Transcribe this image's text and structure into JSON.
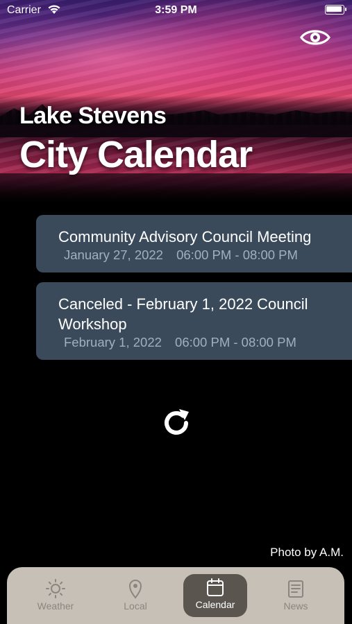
{
  "status_bar": {
    "carrier": "Carrier",
    "time": "3:59 PM"
  },
  "header": {
    "city": "Lake Stevens",
    "title": "City Calendar"
  },
  "icons": {
    "visibility": "eye-icon",
    "refresh": "refresh-icon"
  },
  "events": [
    {
      "title": "Community Advisory Council Meeting",
      "date": "January 27, 2022",
      "time": "06:00 PM - 08:00 PM"
    },
    {
      "title": "Canceled - February 1, 2022 Council Workshop",
      "date": "February 1, 2022",
      "time": "06:00 PM - 08:00 PM"
    }
  ],
  "photo_credit": "Photo by A.M.",
  "tabs": [
    {
      "label": "Weather",
      "icon": "sun-icon",
      "active": false
    },
    {
      "label": "Local",
      "icon": "location-pin-icon",
      "active": false
    },
    {
      "label": "Calendar",
      "icon": "calendar-icon",
      "active": true
    },
    {
      "label": "News",
      "icon": "news-icon",
      "active": false
    }
  ],
  "colors": {
    "card": "#3a4a5a",
    "meta_text": "#9fb0c2",
    "tabbar": "#c7c0b6",
    "tab_active": "#5a564f"
  }
}
